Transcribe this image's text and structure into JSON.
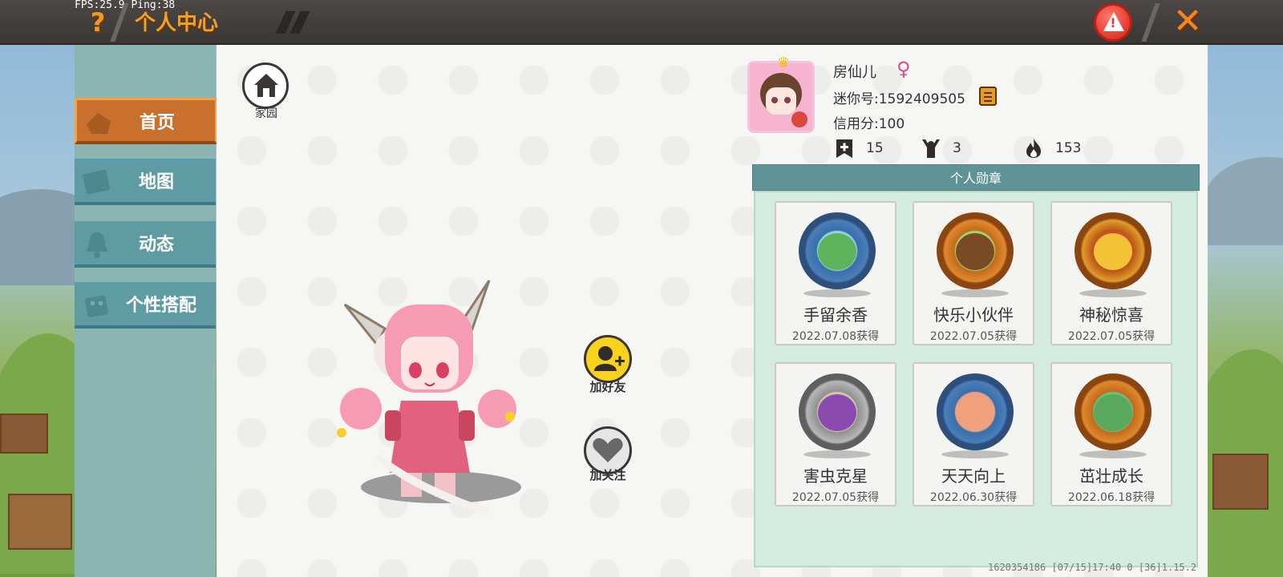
{
  "hud": {
    "fps": "FPS:25.9",
    "ping": "Ping:38"
  },
  "topbar": {
    "help_label": "?",
    "title": "个人中心",
    "close_label": "✕",
    "warn_label": "!"
  },
  "nav": {
    "items": [
      {
        "label": "首页",
        "icon": "home-wall-icon",
        "active": true
      },
      {
        "label": "地图",
        "icon": "map-icon",
        "active": false
      },
      {
        "label": "动态",
        "icon": "bell-icon",
        "active": false
      },
      {
        "label": "个性搭配",
        "icon": "outfit-icon",
        "active": false
      }
    ]
  },
  "home": {
    "label": "家园",
    "icon": "house-icon"
  },
  "actions": {
    "add_friend": {
      "label": "加好友",
      "icon": "add-friend-icon"
    },
    "follow": {
      "label": "加关注",
      "icon": "heart-icon"
    }
  },
  "profile": {
    "username": "房仙儿",
    "gender_symbol": "♀",
    "mini_id": "迷你号:1592409505",
    "credit": "信用分:100",
    "stats": [
      {
        "icon": "bookmark-plus-icon",
        "value": "15"
      },
      {
        "icon": "cheer-icon",
        "value": "3"
      },
      {
        "icon": "flame-icon",
        "value": "153"
      }
    ]
  },
  "badges": {
    "header": "个人勋章",
    "items": [
      {
        "name": "手留余香",
        "date": "2022.07.08获得",
        "style": "blue"
      },
      {
        "name": "快乐小伙伴",
        "date": "2022.07.05获得",
        "style": "orange"
      },
      {
        "name": "神秘惊喜",
        "date": "2022.07.05获得",
        "style": "red"
      },
      {
        "name": "害虫克星",
        "date": "2022.07.05获得",
        "style": "stone"
      },
      {
        "name": "天天向上",
        "date": "2022.06.30获得",
        "style": "red2"
      },
      {
        "name": "茁壮成长",
        "date": "2022.06.18获得",
        "style": "green"
      }
    ]
  },
  "footer": {
    "info": "1620354186   [07/15]17:40 0  [36]1.15.2"
  },
  "colors": {
    "accent_orange": "#f5a023",
    "nav_teal": "#5f9ba3",
    "nav_active": "#c9702f",
    "badge_header": "#5e9497",
    "badge_area": "#d3ecdf",
    "gender_pink": "#e24a8b"
  }
}
